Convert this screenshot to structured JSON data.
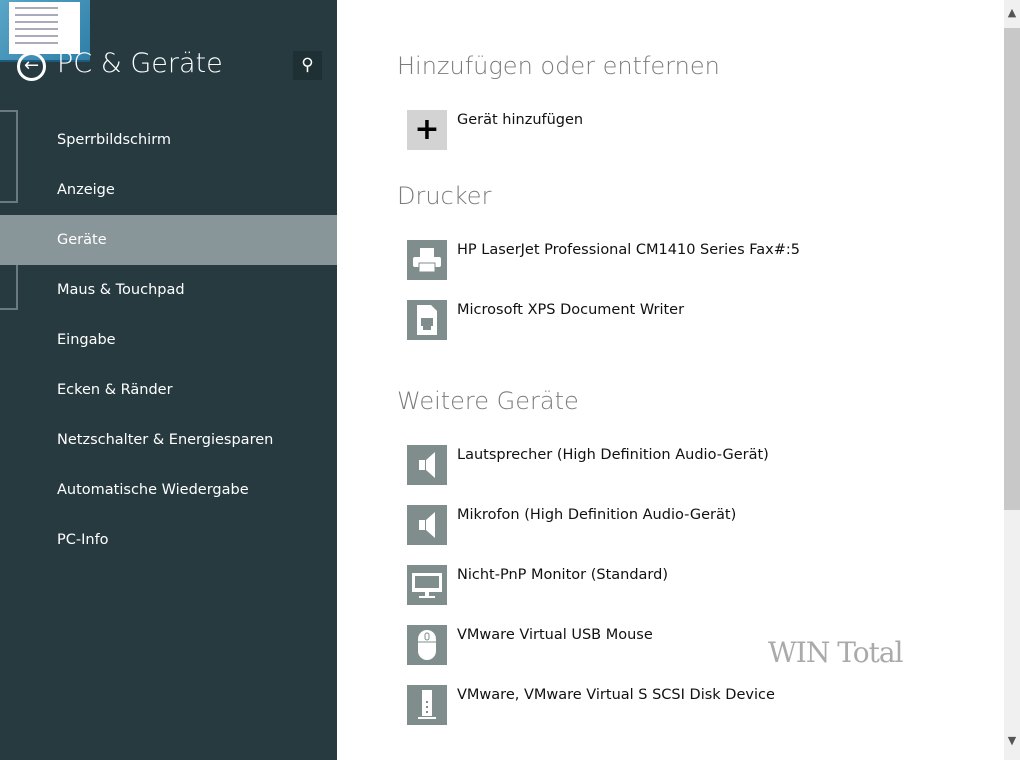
{
  "sidebar": {
    "title": "PC & Geräte",
    "items": [
      {
        "label": "Sperrbildschirm"
      },
      {
        "label": "Anzeige"
      },
      {
        "label": "Geräte",
        "selected": true
      },
      {
        "label": "Maus & Touchpad"
      },
      {
        "label": "Eingabe"
      },
      {
        "label": "Ecken & Ränder"
      },
      {
        "label": "Netzschalter & Energiesparen"
      },
      {
        "label": "Automatische Wiedergabe"
      },
      {
        "label": "PC-Info"
      }
    ]
  },
  "main": {
    "add_section": {
      "heading": "Hinzufügen oder entfernen",
      "add_label": "Gerät hinzufügen"
    },
    "printers": {
      "heading": "Drucker",
      "items": [
        {
          "label": "HP LaserJet Professional CM1410 Series Fax#:5",
          "icon": "printer-icon"
        },
        {
          "label": "Microsoft XPS Document Writer",
          "icon": "document-printer-icon"
        }
      ]
    },
    "other": {
      "heading": "Weitere Geräte",
      "items": [
        {
          "label": "Lautsprecher (High Definition Audio-Gerät)",
          "icon": "speaker-icon"
        },
        {
          "label": "Mikrofon (High Definition Audio-Gerät)",
          "icon": "speaker-icon"
        },
        {
          "label": "Nicht-PnP Monitor (Standard)",
          "icon": "monitor-icon"
        },
        {
          "label": "VMware Virtual USB Mouse",
          "icon": "mouse-icon"
        },
        {
          "label": "VMware, VMware Virtual S SCSI Disk Device",
          "icon": "disk-icon"
        }
      ]
    }
  },
  "watermark": "WIN Total",
  "colors": {
    "sidebar": "#263a40",
    "selected": "#889599",
    "icon_bg": "#7f8d8d"
  }
}
